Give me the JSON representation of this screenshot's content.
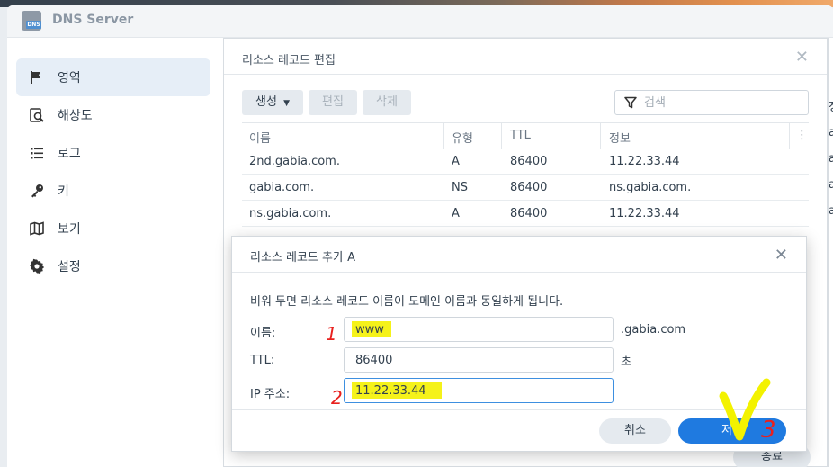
{
  "app": {
    "title": "DNS Server",
    "icon_tag": "DNS"
  },
  "sidebar": {
    "items": [
      {
        "label": "영역",
        "icon": "flag-icon",
        "active": true
      },
      {
        "label": "해상도",
        "icon": "resolution-icon",
        "active": false
      },
      {
        "label": "로그",
        "icon": "list-icon",
        "active": false
      },
      {
        "label": "키",
        "icon": "key-icon",
        "active": false
      },
      {
        "label": "보기",
        "icon": "map-icon",
        "active": false
      },
      {
        "label": "설정",
        "icon": "gear-icon",
        "active": false
      }
    ]
  },
  "panel": {
    "title": "리소스 레코드 편집",
    "toolbar": {
      "create_label": "생성",
      "edit_label": "편집",
      "delete_label": "삭제"
    },
    "search": {
      "placeholder": "검색",
      "value": ""
    },
    "table": {
      "columns": [
        "이름",
        "유형",
        "TTL",
        "정보"
      ],
      "rows": [
        [
          "2nd.gabia.com.",
          "A",
          "86400",
          "11.22.33.44"
        ],
        [
          "gabia.com.",
          "NS",
          "86400",
          "ns.gabia.com."
        ],
        [
          "ns.gabia.com.",
          "A",
          "86400",
          "11.22.33.44"
        ]
      ]
    },
    "footer_button": "종료"
  },
  "right_peek": {
    "header": "정",
    "rows": [
      "a",
      "a",
      "a",
      "a"
    ]
  },
  "dialog": {
    "title": "리소스 레코드 추가 A",
    "description": "비워 두면 리소스 레코드 이름이 도메인 이름과 동일하게 됩니다.",
    "fields": {
      "name": {
        "label": "이름:",
        "value": "www",
        "suffix": ".gabia.com"
      },
      "ttl": {
        "label": "TTL:",
        "value": "86400",
        "suffix": "초"
      },
      "ip": {
        "label": "IP 주소:",
        "value": "11.22.33.44"
      }
    },
    "cancel_label": "취소",
    "save_label": "저장"
  },
  "annotations": {
    "step1": "1",
    "step2": "2",
    "step3": "3",
    "ink_color": "#e8201e",
    "highlight_color": "#f5f21a",
    "check_color": "#f3f200"
  }
}
